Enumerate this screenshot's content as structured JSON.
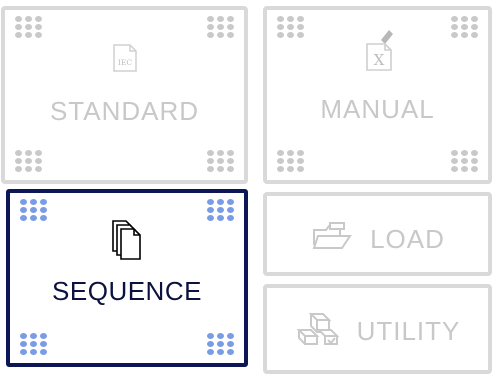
{
  "tiles": {
    "standard": {
      "label": "STANDARD",
      "icon": "iec-document-icon",
      "icon_text": "IEC"
    },
    "manual": {
      "label": "MANUAL",
      "icon": "manual-pencil-doc-icon",
      "icon_text": "X"
    },
    "sequence": {
      "label": "SEQUENCE",
      "icon": "stacked-pages-icon",
      "selected": true
    },
    "load": {
      "label": "LOAD",
      "icon": "folder-open-icon"
    },
    "utility": {
      "label": "UTILITY",
      "icon": "blocks-icon"
    }
  },
  "colors": {
    "disabled_border": "#d9d9d9",
    "disabled_text": "#c8c8c8",
    "selected_border": "#0e1755",
    "selected_text": "#0c1240",
    "selected_dots": "#7a9be6",
    "disabled_dots": "#c9c9c9"
  }
}
